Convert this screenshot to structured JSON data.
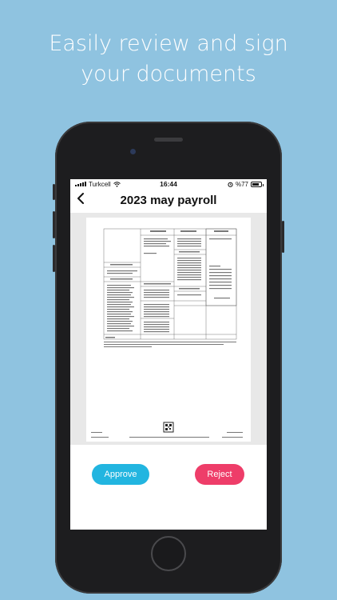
{
  "headline": {
    "line1": "Easily review and sign",
    "line2": "your documents"
  },
  "status_bar": {
    "carrier": "Turkcell",
    "time": "16:44",
    "battery": "%77",
    "battery_level": 0.77
  },
  "nav": {
    "back_icon": "chevron-left-icon",
    "title": "2023 may payroll"
  },
  "actions": {
    "approve_label": "Approve",
    "reject_label": "Reject"
  },
  "colors": {
    "background": "#8fc3e0",
    "approve": "#22b5e0",
    "reject": "#ee3d69"
  }
}
